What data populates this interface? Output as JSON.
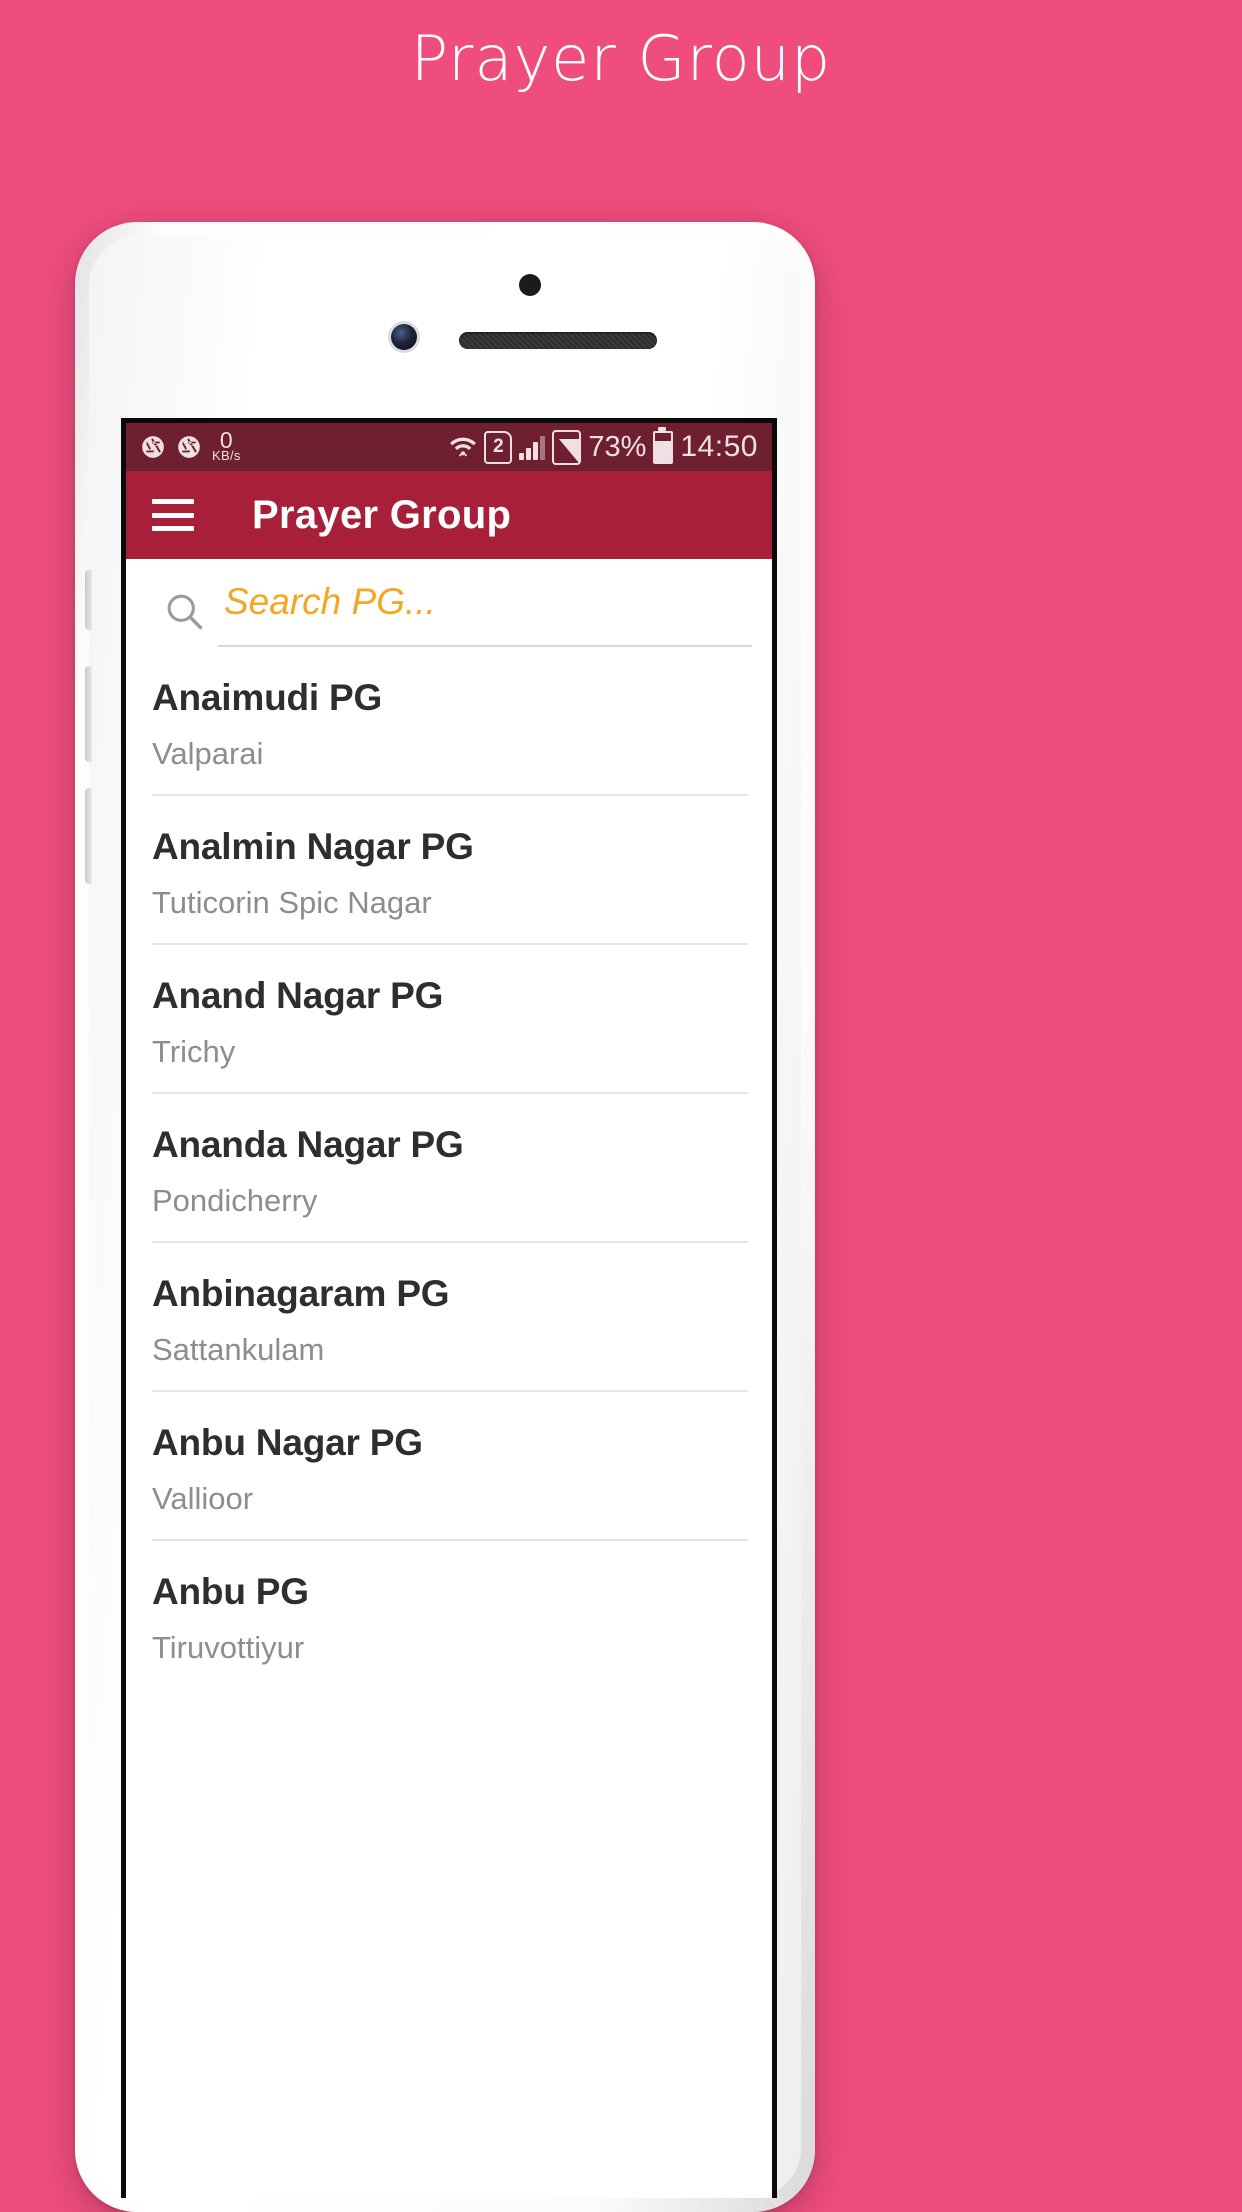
{
  "page": {
    "title": "Prayer Group",
    "background_color": "#ee4d7e"
  },
  "phone": {
    "status_bar": {
      "background_color": "#6e1f30",
      "camera_icon_1": "shutter-icon",
      "camera_icon_2": "shutter-icon",
      "net_speed_value": "0",
      "net_speed_unit": "KB/s",
      "wifi_icon": "wifi-icon",
      "sim_label": "2",
      "signal_icon": "signal-bars-icon",
      "signal2_icon": "signal-box-icon",
      "battery_percent": "73%",
      "battery_icon": "battery-icon",
      "time": "14:50"
    },
    "app_bar": {
      "background_color": "#a81f3a",
      "menu_icon": "hamburger-menu-icon",
      "title": "Prayer Group"
    },
    "search": {
      "icon": "search-icon",
      "value": "",
      "placeholder": "Search PG...",
      "text_color": "#f5a623"
    },
    "list": {
      "items": [
        {
          "name": "Anaimudi PG",
          "location": "Valparai"
        },
        {
          "name": "Analmin Nagar PG",
          "location": "Tuticorin Spic Nagar"
        },
        {
          "name": "Anand Nagar PG",
          "location": "Trichy"
        },
        {
          "name": "Ananda Nagar PG",
          "location": "Pondicherry"
        },
        {
          "name": "Anbinagaram PG",
          "location": "Sattankulam"
        },
        {
          "name": "Anbu Nagar PG",
          "location": "Vallioor"
        },
        {
          "name": "Anbu PG",
          "location": "Tiruvottiyur"
        }
      ]
    }
  }
}
